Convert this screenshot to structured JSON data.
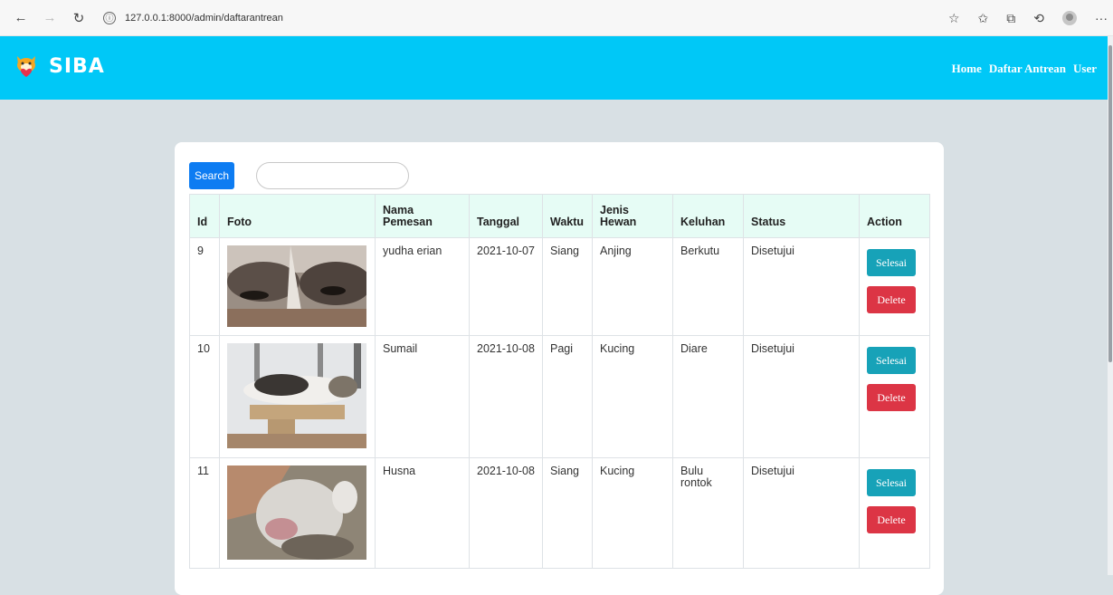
{
  "browser": {
    "url": "127.0.0.1:8000/admin/daftarantrean",
    "info_icon": "ⓘ"
  },
  "navbar": {
    "brand": "SIBA",
    "links": [
      "Home",
      "Daftar Antrean",
      "User"
    ]
  },
  "search": {
    "button_label": "Search",
    "placeholder": ""
  },
  "table": {
    "headers": [
      "Id",
      "Foto",
      "Nama Pemesan",
      "Tanggal",
      "Waktu",
      "Jenis Hewan",
      "Keluhan",
      "Status",
      "Action"
    ],
    "rows": [
      {
        "id": "9",
        "nama": "yudha erian",
        "tanggal": "2021-10-07",
        "waktu": "Siang",
        "jenis": "Anjing",
        "keluhan": "Berkutu",
        "status": "Disetujui",
        "selesai": "Selesai",
        "delete": "Delete"
      },
      {
        "id": "10",
        "nama": "Sumail",
        "tanggal": "2021-10-08",
        "waktu": "Pagi",
        "jenis": "Kucing",
        "keluhan": "Diare",
        "status": "Disetujui",
        "selesai": "Selesai",
        "delete": "Delete"
      },
      {
        "id": "11",
        "nama": "Husna",
        "tanggal": "2021-10-08",
        "waktu": "Siang",
        "jenis": "Kucing",
        "keluhan": "Bulu rontok",
        "status": "Disetujui",
        "selesai": "Selesai",
        "delete": "Delete"
      }
    ]
  },
  "colors": {
    "navbar": "#00c8f7",
    "search_button": "#0d7cf2",
    "selesai_button": "#17a2b8",
    "delete_button": "#dc3545",
    "header_row": "#e6fcf5"
  }
}
